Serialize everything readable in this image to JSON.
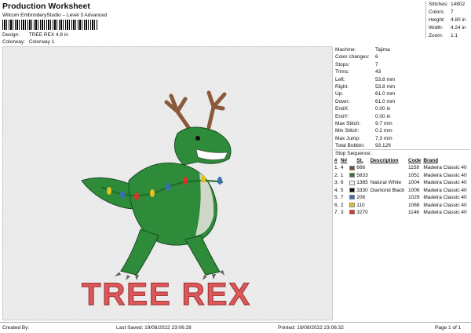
{
  "header": {
    "title": "Production Worksheet",
    "subtitle": "Wilcom EmbroideryStudio – Level 3 Advanced",
    "design_label": "Design:",
    "design_value": "TREE REX 4,8 in",
    "colorway_label": "Colorway:",
    "colorway_value": "Colorway 1"
  },
  "stats": [
    {
      "k": "Stitches:",
      "v": "14802"
    },
    {
      "k": "Colors:",
      "v": "7"
    },
    {
      "k": "Height:",
      "v": "4.80 in"
    },
    {
      "k": "Width:",
      "v": "4.24 in"
    },
    {
      "k": "Zoom:",
      "v": "1:1"
    }
  ],
  "design": {
    "text": "TREE REX",
    "colors": {
      "green": "#2e8b3a",
      "dark_green": "#1f6a2b",
      "antler": "#8a5a3a",
      "text_red": "#e0575a"
    }
  },
  "machine_info": [
    {
      "k": "Machine:",
      "v": "Tajima"
    },
    {
      "k": "Color changes:",
      "v": "6"
    },
    {
      "k": "Stops:",
      "v": "7"
    },
    {
      "k": "Trims:",
      "v": "43"
    },
    {
      "k": "Left:",
      "v": "53.8 mm"
    },
    {
      "k": "Right:",
      "v": "53.8 mm"
    },
    {
      "k": "Up:",
      "v": "61.0 mm"
    },
    {
      "k": "Down:",
      "v": "61.0 mm"
    },
    {
      "k": "EndX:",
      "v": "0.00 in"
    },
    {
      "k": "EndY:",
      "v": "0.00 in"
    },
    {
      "k": "Max Stitch:",
      "v": "9.7 mm"
    },
    {
      "k": "Min Stitch:",
      "v": "0.2 mm"
    },
    {
      "k": "Max Jump:",
      "v": "7.3 mm"
    },
    {
      "k": "Total Bobbin:",
      "v": "93.12ft"
    }
  ],
  "stop_sequence": {
    "title": "Stop Sequence:",
    "headers": [
      "#",
      "N#",
      "",
      "St.",
      "Description",
      "Code",
      "Brand"
    ],
    "rows": [
      {
        "n": "1.",
        "needle": "4",
        "color": "#7b4a36",
        "st": "666",
        "desc": "",
        "code": "1158",
        "brand": "Madeira Classic 40"
      },
      {
        "n": "2.",
        "needle": "1",
        "color": "#2e7d3a",
        "st": "5833",
        "desc": "",
        "code": "1051",
        "brand": "Madeira Classic 40"
      },
      {
        "n": "3.",
        "needle": "6",
        "color": "#f2f2f2",
        "st": "1385",
        "desc": "Natural White",
        "code": "1004",
        "brand": "Madeira Classic 40"
      },
      {
        "n": "4.",
        "needle": "5",
        "color": "#111111",
        "st": "3330",
        "desc": "Diamond Black",
        "code": "1006",
        "brand": "Madeira Classic 40"
      },
      {
        "n": "5.",
        "needle": "7",
        "color": "#3a6fb5",
        "st": "206",
        "desc": "",
        "code": "1029",
        "brand": "Madeira Classic 40"
      },
      {
        "n": "6.",
        "needle": "2",
        "color": "#e6c21a",
        "st": "110",
        "desc": "",
        "code": "1068",
        "brand": "Madeira Classic 40"
      },
      {
        "n": "7.",
        "needle": "3",
        "color": "#d9342b",
        "st": "3270",
        "desc": "",
        "code": "1146",
        "brand": "Madeira Classic 40"
      }
    ]
  },
  "footer": {
    "created": "Created By:",
    "saved": "Last Saved: 19/08/2022 23:06:28",
    "printed": "Printed: 19/08/2022 23:06:32",
    "page": "Page 1 of 1"
  }
}
